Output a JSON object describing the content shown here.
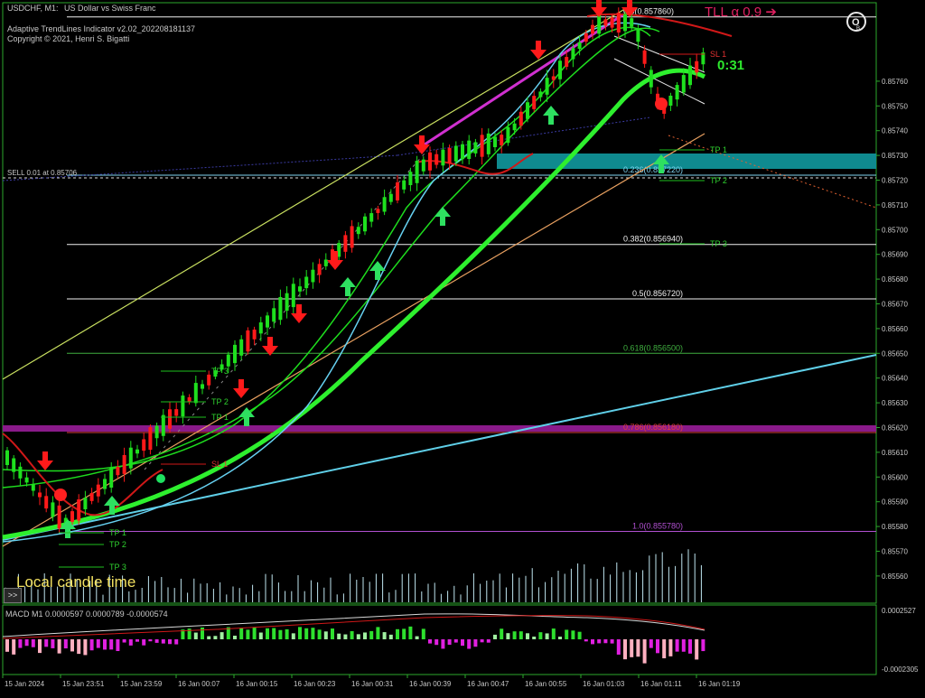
{
  "header": {
    "symbol_timeframe": "USDCHF, M1:",
    "symbol_description": "US Dollar vs Swiss Franc",
    "indicator_name": "Adaptive TrendLines Indicator v2.02_202208181137",
    "copyright": "Copyright © 2021, Henri S. Bigatti"
  },
  "tll_label": "TLL α 0.9 ➔",
  "countdown": "0:31",
  "local_time_label": "Local candle time",
  "toggle_label": ">>",
  "sell_order_label": "SELL 0.01 at 0.85706",
  "fib_levels": [
    {
      "label": "0.0(0.857860)",
      "price": 0.85786,
      "color": "#f0f0f0"
    },
    {
      "label": "0.236(0.857220)",
      "price": 0.85722,
      "color": "#7fd3f0"
    },
    {
      "label": "0.382(0.856940)",
      "price": 0.85694,
      "color": "#f0f0f0"
    },
    {
      "label": "0.5(0.856720)",
      "price": 0.85672,
      "color": "#f0f0f0"
    },
    {
      "label": "0.618(0.856500)",
      "price": 0.8565,
      "color": "#3fae3f"
    },
    {
      "label": "0.786(0.856180)",
      "price": 0.85618,
      "color": "#e04040"
    },
    {
      "label": "1.0(0.855780)",
      "price": 0.85578,
      "color": "#b050d0"
    }
  ],
  "price_axis": {
    "ticks": [
      "0.85760",
      "0.85750",
      "0.85740",
      "0.85730",
      "0.85720",
      "0.85710",
      "0.85700",
      "0.85690",
      "0.85680",
      "0.85670",
      "0.85660",
      "0.85650",
      "0.85640",
      "0.85630",
      "0.85620",
      "0.85610",
      "0.85600",
      "0.85590",
      "0.85580",
      "0.85570",
      "0.85560"
    ],
    "range": [
      0.85549,
      0.85791
    ]
  },
  "time_axis": [
    "15 Jan 2024",
    "15 Jan 23:51",
    "15 Jan 23:59",
    "16 Jan 00:07",
    "16 Jan 00:15",
    "16 Jan 00:23",
    "16 Jan 00:31",
    "16 Jan 00:39",
    "16 Jan 00:47",
    "16 Jan 00:55",
    "16 Jan 01:03",
    "16 Jan 01:11",
    "16 Jan 01:19"
  ],
  "tp_sl_labels": {
    "right": [
      "SL 1",
      "TP 1",
      "TP 2",
      "TP 3"
    ],
    "mid": [
      "TP 3",
      "TP 2",
      "TP 1",
      "SL 1"
    ],
    "left": [
      "TP 1",
      "TP 2",
      "TP 3"
    ]
  },
  "macd": {
    "label": "MACD M1 0.0000597 0.0000789 -0.0000574",
    "axis_top": "0.0002527",
    "axis_bottom": "-0.0002305"
  },
  "colors": {
    "background": "#000000",
    "bull": "#1ee01e",
    "bear": "#ff1a1a",
    "supply_zone": "#0f8a8f",
    "magenta_zone": "#8a1a8a",
    "grid": "#00b400"
  }
}
